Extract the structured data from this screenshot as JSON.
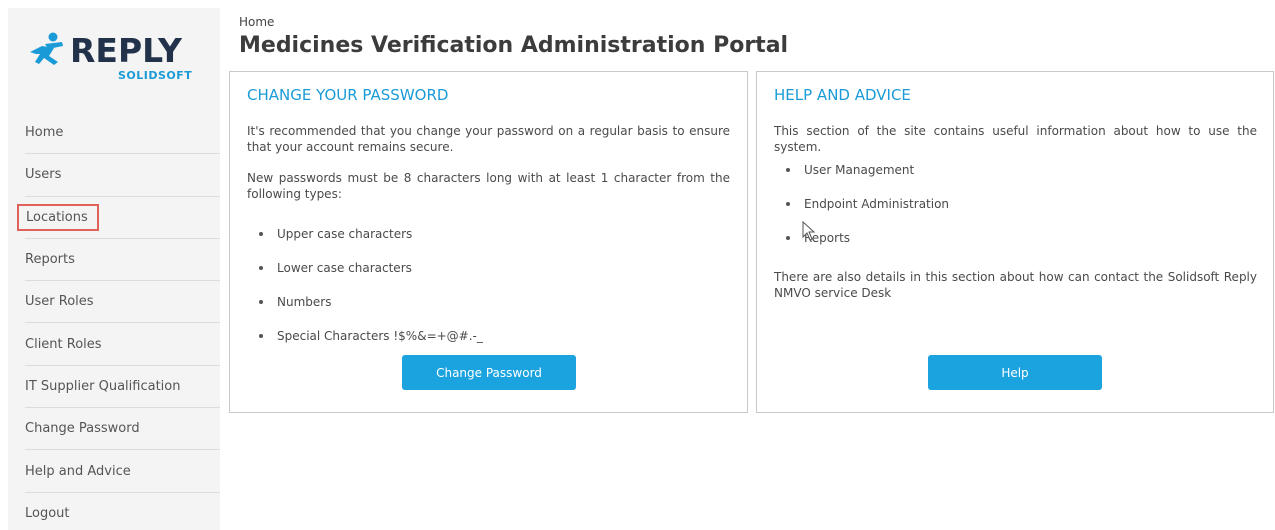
{
  "brand": {
    "name": "REPLY",
    "sub": "SOLIDSOFT",
    "colors": {
      "dark": "#22324b",
      "accent": "#1a9bd7"
    }
  },
  "sidebar": {
    "items": [
      {
        "label": "Home"
      },
      {
        "label": "Users"
      },
      {
        "label": "Locations"
      },
      {
        "label": "Reports"
      },
      {
        "label": "User Roles"
      },
      {
        "label": "Client Roles"
      },
      {
        "label": "IT Supplier Qualification"
      },
      {
        "label": "Change Password"
      },
      {
        "label": "Help and Advice"
      },
      {
        "label": "Logout"
      }
    ]
  },
  "header": {
    "breadcrumb": "Home",
    "title": "Medicines Verification Administration Portal"
  },
  "change_password": {
    "heading": "CHANGE YOUR PASSWORD",
    "para1": "It's recommended that you change your password on a regular basis to ensure that your account remains secure.",
    "para2": "New passwords must be 8 characters long with at least 1 character from the following types:",
    "items": [
      "Upper case characters",
      "Lower case characters",
      "Numbers",
      "Special Characters !$%&=+@#.-_"
    ],
    "button": "Change Password"
  },
  "help": {
    "heading": "HELP AND ADVICE",
    "para1": "This section of the site contains useful information about how to use the system.",
    "items": [
      "User Management",
      "Endpoint Administration",
      "Reports"
    ],
    "para2": "There are also details in this section about how can contact the Solidsoft Reply NMVO service Desk",
    "button": "Help"
  },
  "colors": {
    "button": "#1ba3df",
    "heading": "#1a9bd7",
    "highlight_border": "#e0605a"
  }
}
